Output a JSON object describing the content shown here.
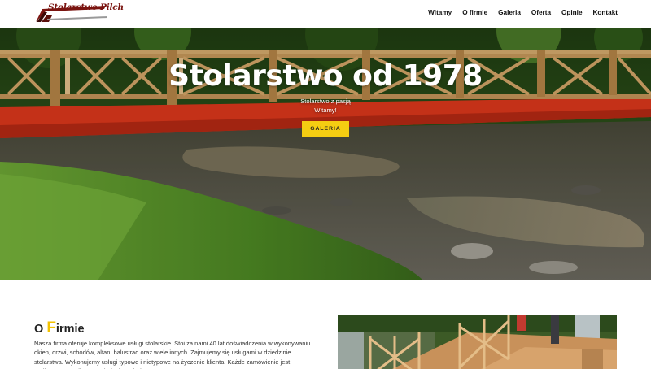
{
  "header": {
    "logo_text": "Stolarstwo Pilch",
    "nav": [
      "Witamy",
      "O firmie",
      "Galeria",
      "Oferta",
      "Opinie",
      "Kontakt"
    ]
  },
  "hero": {
    "title": "Stolarstwo od 1978",
    "subtitle_1": "Stolarstwo z pasją",
    "subtitle_2": "Witamy!",
    "button_label": "GALERIA"
  },
  "about": {
    "title_first_letter": "F",
    "title_prefix": "O ",
    "title_rest": "irmie",
    "text": "Nasza firma oferuje kompleksowe usługi stolarskie. Stoi za nami 40 lat doświadczenia w wykonywaniu okien, drzwi, schodów, altan, balustrad oraz wiele innych. Zajmujemy się usługami w dziedzinie stolarstwa. Wykonujemy usługi typowe i nietypowe na życzenie klienta. Każde zamówienie jest realizowane według uwagbek zleceniodawcy"
  },
  "colors": {
    "accent": "#f5cd12",
    "logo": "#7a1410",
    "bridge_red": "#e0381c"
  },
  "icons": {
    "logo": "carpentry-logo-icon"
  }
}
